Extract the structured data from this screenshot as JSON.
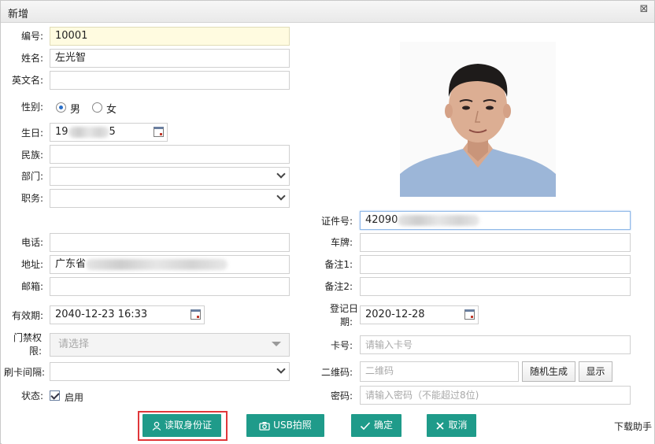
{
  "window": {
    "title": "新增",
    "close_glyph": "⊠"
  },
  "form": {
    "number": {
      "label": "编号:",
      "value": "10001"
    },
    "name": {
      "label": "姓名:",
      "value": "左光智"
    },
    "english_name": {
      "label": "英文名:",
      "value": ""
    },
    "gender": {
      "label": "性别:",
      "options": [
        "男",
        "女"
      ],
      "selected": "男"
    },
    "birthday": {
      "label": "生日:",
      "value_prefix": "19",
      "value_suffix": "5"
    },
    "ethnicity": {
      "label": "民族:",
      "value": ""
    },
    "department": {
      "label": "部门:",
      "value": ""
    },
    "position": {
      "label": "职务:",
      "value": ""
    },
    "id_number": {
      "label": "证件号:",
      "value_prefix": "42090"
    },
    "phone": {
      "label": "电话:",
      "value": ""
    },
    "plate": {
      "label": "车牌:",
      "value": ""
    },
    "address": {
      "label": "地址:",
      "value_prefix": "广东省"
    },
    "remark1": {
      "label": "备注1:",
      "value": ""
    },
    "email": {
      "label": "邮箱:",
      "value": ""
    },
    "remark2": {
      "label": "备注2:",
      "value": ""
    },
    "valid_until": {
      "label": "有效期:",
      "value": "2040-12-23 16:33"
    },
    "register_date": {
      "label_line1": "登记日",
      "label_line2": "期:",
      "value": "2020-12-28"
    },
    "access_rights": {
      "label_line1": "门禁权",
      "label_line2": "限:",
      "placeholder": "请选择"
    },
    "card_number": {
      "label": "卡号:",
      "placeholder": "请输入卡号"
    },
    "swipe_interval": {
      "label": "刷卡间隔:",
      "value": ""
    },
    "qrcode": {
      "label": "二维码:",
      "placeholder": "二维码",
      "generate_label": "随机生成",
      "show_label": "显示"
    },
    "status": {
      "label": "状态:",
      "checkbox_label": "启用",
      "checked": true
    },
    "password": {
      "label": "密码:",
      "placeholder": "请输入密码（不能超过8位)"
    }
  },
  "actions": {
    "read_id": "读取身份证",
    "usb_photo": "USB拍照",
    "confirm": "确定",
    "cancel": "取消",
    "download_helper": "下载助手"
  },
  "colors": {
    "accent_button": "#1f9b8a",
    "highlight_frame": "#e0373a",
    "yellow_field": "#fffbe0"
  }
}
